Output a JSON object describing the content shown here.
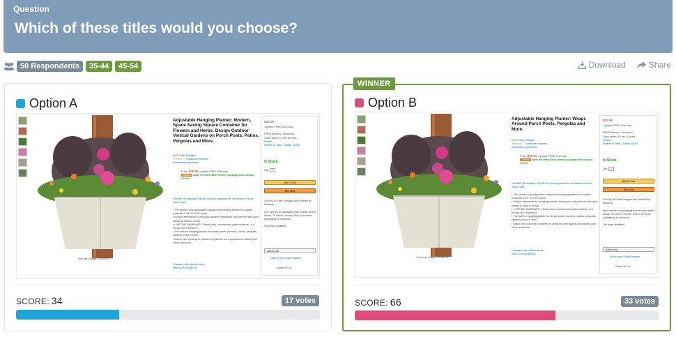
{
  "question": {
    "kicker": "Question",
    "text": "Which of these titles would you choose?"
  },
  "meta": {
    "respondents": "50 Respondents",
    "age_groups": [
      "35-44",
      "45-54"
    ]
  },
  "actions": {
    "download": "Download",
    "share": "Share"
  },
  "winner_label": "WINNER",
  "options": [
    {
      "name": "Option A",
      "color": "#1ea4d9",
      "score_label": "SCORE:",
      "score": 34,
      "score_text": "34",
      "votes_text": "17 votes",
      "product_title": "Adjustable Hanging Planter: Modern, Space Saving Square Container for Flowers and Herbs. Design Outdoor Vertical Gardens on Porch Posts, Patios, Pergolas and More."
    },
    {
      "name": "Option B",
      "color": "#e14b7b",
      "score_label": "SCORE:",
      "score": 66,
      "score_text": "66",
      "votes_text": "33 votes",
      "product_title": "Adjustable Hanging Planter: Wraps Around Porch Posts, Pergolas and More."
    }
  ],
  "product": {
    "brand": "by El Patio Designs",
    "reviews": "7 customer reviews",
    "answered": "8 answered questions",
    "price_prefix": "Price:",
    "price": "$39.95",
    "prime_delivery": "FREE One-Day",
    "coupon_label": "Coupon:",
    "coupon_text": "Save an extra $3.00 when you apply this coupon.",
    "details": "Details",
    "card_offer": "Get $60 off instantly: Pay $0.00 upon approval for the Amazon Prime Store Card.",
    "bullets": [
      "The world's only adjustable wraparound hanging planter for square posts fits 4\"x4\" to 6\"x6\" posts",
      "Unique alternative to hanging baskets, flowerpots, tall planters and plant stands is easy to install",
      "LIFETIME WARRANTY Heavy duty, commercial grade material - if it breaks we'll replace it",
      "The perfect hanging planter for house posts, porches, patios, pergolas, mailbox posts & more",
      "Brand new concept in planters is great for curb appeal and makes your home stand out"
    ],
    "compare": "Compare with similar items",
    "new_from": "New (1) from $39.95",
    "rollover": "Roll over image to zoom in",
    "buybox_price": "$39.95",
    "free_delivery": "FREE delivery: Tomorrow",
    "order_within": "Order within 10 hrs 15 mins",
    "deliver_to": "Deliver to Todd - Dallas 75218",
    "in_stock": "In Stock.",
    "qty_label": "Qty:",
    "qty_value": "1",
    "add_to_cart": "Add to Cart",
    "buy_now": "Buy Now",
    "sold_by": "Sold by El Patio Designs and Fulfilled by Amazon.",
    "packaging": "Item arrives in packaging that reveals what's inside. To hide it, choose Ship in Amazon packaging at checkout.",
    "gift_wrap": "Gift-wrap available.",
    "add_to_list": "Add to List",
    "dash": "Add to your Dash Buttons",
    "share": "Share"
  }
}
